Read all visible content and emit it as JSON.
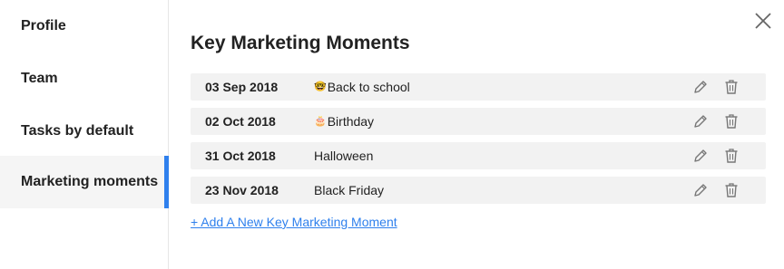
{
  "sidebar": {
    "items": [
      {
        "label": "Profile"
      },
      {
        "label": "Team"
      },
      {
        "label": "Tasks by default"
      },
      {
        "label": "Marketing moments",
        "active": true
      }
    ]
  },
  "main": {
    "title": "Key Marketing Moments",
    "rows": [
      {
        "date": "03 Sep 2018",
        "emoji": "🤓",
        "name": "Back to school"
      },
      {
        "date": "02 Oct 2018",
        "emoji": "🎂",
        "name": "Birthday"
      },
      {
        "date": "31 Oct 2018",
        "emoji": "",
        "name": "Halloween"
      },
      {
        "date": "23 Nov 2018",
        "emoji": "",
        "name": "Black Friday"
      }
    ],
    "add_link": "+ Add A New Key Marketing Moment"
  },
  "icons": {
    "close": "close-icon",
    "edit": "pencil-icon",
    "delete": "trash-icon"
  },
  "colors": {
    "accent": "#2f80ed",
    "row_bg": "#f2f2f2",
    "active_bg": "#f5f5f5"
  }
}
